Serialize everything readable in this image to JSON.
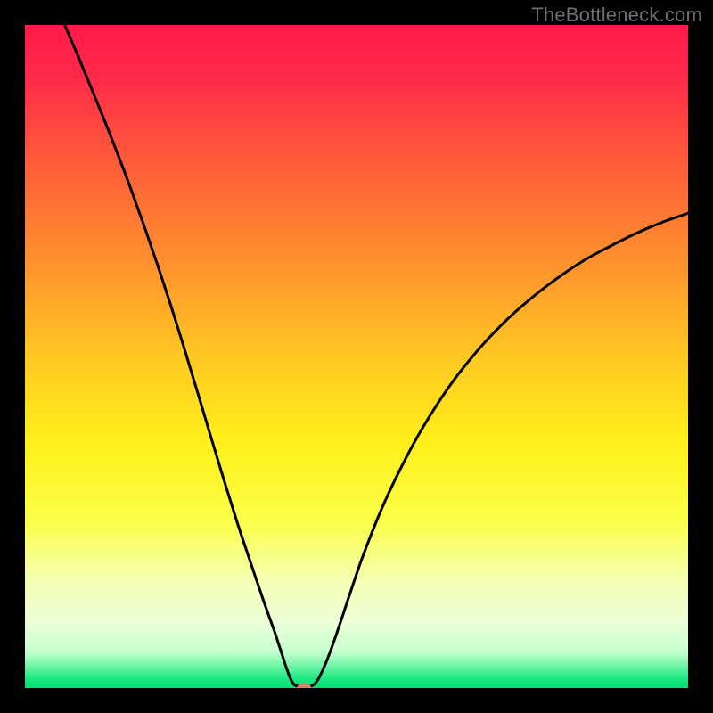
{
  "watermark": "TheBottleneck.com",
  "chart_data": {
    "type": "line",
    "title": "",
    "xlabel": "",
    "ylabel": "",
    "xlim": [
      0,
      100
    ],
    "ylim": [
      0,
      100
    ],
    "background_gradient": {
      "stops": [
        {
          "offset": 0.0,
          "color": "#ff1a4b"
        },
        {
          "offset": 0.08,
          "color": "#ff2a49"
        },
        {
          "offset": 0.2,
          "color": "#ff5a3a"
        },
        {
          "offset": 0.35,
          "color": "#ff8e2e"
        },
        {
          "offset": 0.5,
          "color": "#ffc823"
        },
        {
          "offset": 0.63,
          "color": "#fff01a"
        },
        {
          "offset": 0.75,
          "color": "#fbff4a"
        },
        {
          "offset": 0.84,
          "color": "#f6ffb4"
        },
        {
          "offset": 0.9,
          "color": "#ecffd8"
        },
        {
          "offset": 0.945,
          "color": "#c7ffd0"
        },
        {
          "offset": 0.965,
          "color": "#77f6a8"
        },
        {
          "offset": 0.985,
          "color": "#1fe884"
        },
        {
          "offset": 1.0,
          "color": "#00e072"
        }
      ]
    },
    "series": [
      {
        "name": "bottleneck-curve",
        "color": "#000000",
        "x": [
          6,
          8,
          10,
          12,
          14,
          16,
          18,
          20,
          22,
          24,
          26,
          28,
          30,
          32,
          34,
          36,
          37.5,
          38.5,
          39.3,
          40,
          40.5,
          41,
          41.8,
          43.2,
          44.2,
          45.5,
          47,
          49,
          51,
          54,
          57,
          60,
          64,
          68,
          72,
          76,
          80,
          84,
          88,
          92,
          96,
          100
        ],
        "y": [
          100,
          95.3,
          90.5,
          85.6,
          80.5,
          75.2,
          69.6,
          63.8,
          57.7,
          51.3,
          44.7,
          38,
          31.4,
          25,
          19,
          13.1,
          8.9,
          5.9,
          3.4,
          1.5,
          0.6,
          0.3,
          0.3,
          0.3,
          1.3,
          4.1,
          8.2,
          14.2,
          20,
          27.5,
          33.8,
          39.3,
          45.5,
          50.6,
          54.9,
          58.5,
          61.6,
          64.3,
          66.5,
          68.5,
          70.2,
          71.6
        ]
      }
    ],
    "marker": {
      "name": "min-point",
      "x": 42.1,
      "y": 0,
      "color": "#cf8673",
      "rx": 8,
      "ry": 5.5
    }
  }
}
